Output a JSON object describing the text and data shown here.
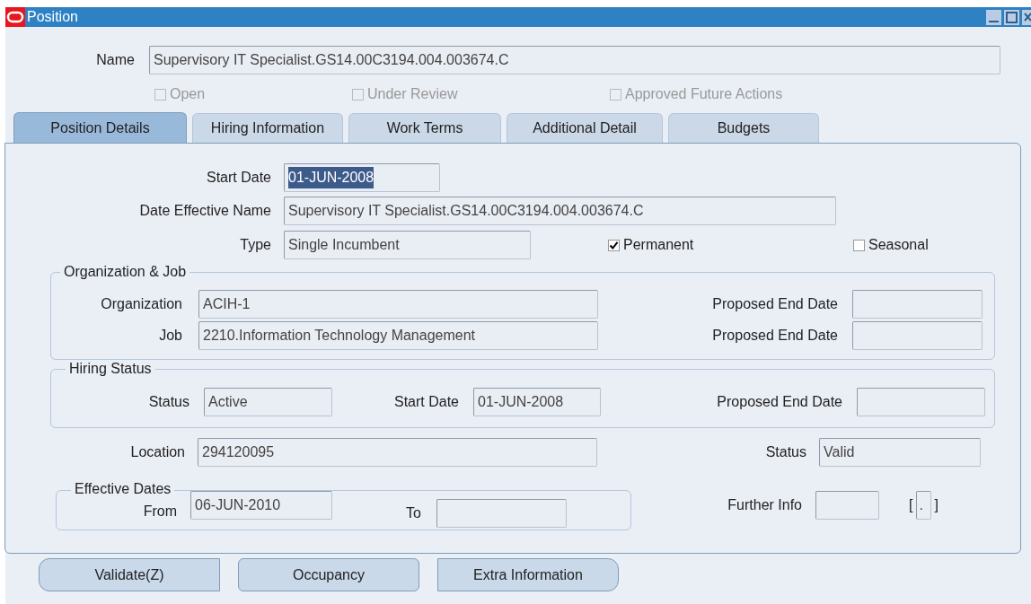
{
  "window": {
    "title": "Position"
  },
  "name": {
    "label": "Name",
    "value": "Supervisory IT Specialist.GS14.00C3194.004.003674.C"
  },
  "flags": [
    {
      "label": "Open",
      "checked": false,
      "disabled": true
    },
    {
      "label": "Under Review",
      "checked": false,
      "disabled": true
    },
    {
      "label": "Approved Future Actions",
      "checked": false,
      "disabled": true
    }
  ],
  "tabs": [
    {
      "label": "Position Details",
      "selected": true
    },
    {
      "label": "Hiring Information",
      "selected": false
    },
    {
      "label": "Work Terms",
      "selected": false
    },
    {
      "label": "Additional Detail",
      "selected": false
    },
    {
      "label": "Budgets",
      "selected": false
    }
  ],
  "details": {
    "start_date": {
      "label": "Start Date",
      "value": "01-JUN-2008",
      "highlighted": true
    },
    "date_effective_name": {
      "label": "Date Effective Name",
      "value": "Supervisory IT Specialist.GS14.00C3194.004.003674.C"
    },
    "type": {
      "label": "Type",
      "value": "Single Incumbent"
    },
    "permanent": {
      "label": "Permanent",
      "checked": true
    },
    "seasonal": {
      "label": "Seasonal",
      "checked": false
    }
  },
  "organization_job": {
    "title": "Organization & Job",
    "organization": {
      "label": "Organization",
      "value": "ACIH-1"
    },
    "organization_end": {
      "label": "Proposed End Date"
    },
    "job": {
      "label": "Job",
      "value": "2210.Information Technology Management"
    },
    "job_end": {
      "label": "Proposed End Date"
    }
  },
  "hiring_status": {
    "title": "Hiring Status",
    "status": {
      "label": "Status",
      "value": "Active"
    },
    "start_date": {
      "label": "Start Date",
      "value": "01-JUN-2008"
    },
    "proposed_end_date": {
      "label": "Proposed End Date"
    }
  },
  "location": {
    "label": "Location",
    "value": "294120095"
  },
  "status": {
    "label": "Status",
    "value": "Valid"
  },
  "effective_dates": {
    "title": "Effective Dates",
    "from": {
      "label": "From",
      "value": "06-JUN-2010"
    },
    "to": {
      "label": "To"
    }
  },
  "further_info": {
    "label": "Further Info",
    "open_bracket": "[",
    "flex_value": ".",
    "close_bracket": "]"
  },
  "buttons": [
    "Validate(Z)",
    "Occupancy",
    "Extra Information"
  ]
}
